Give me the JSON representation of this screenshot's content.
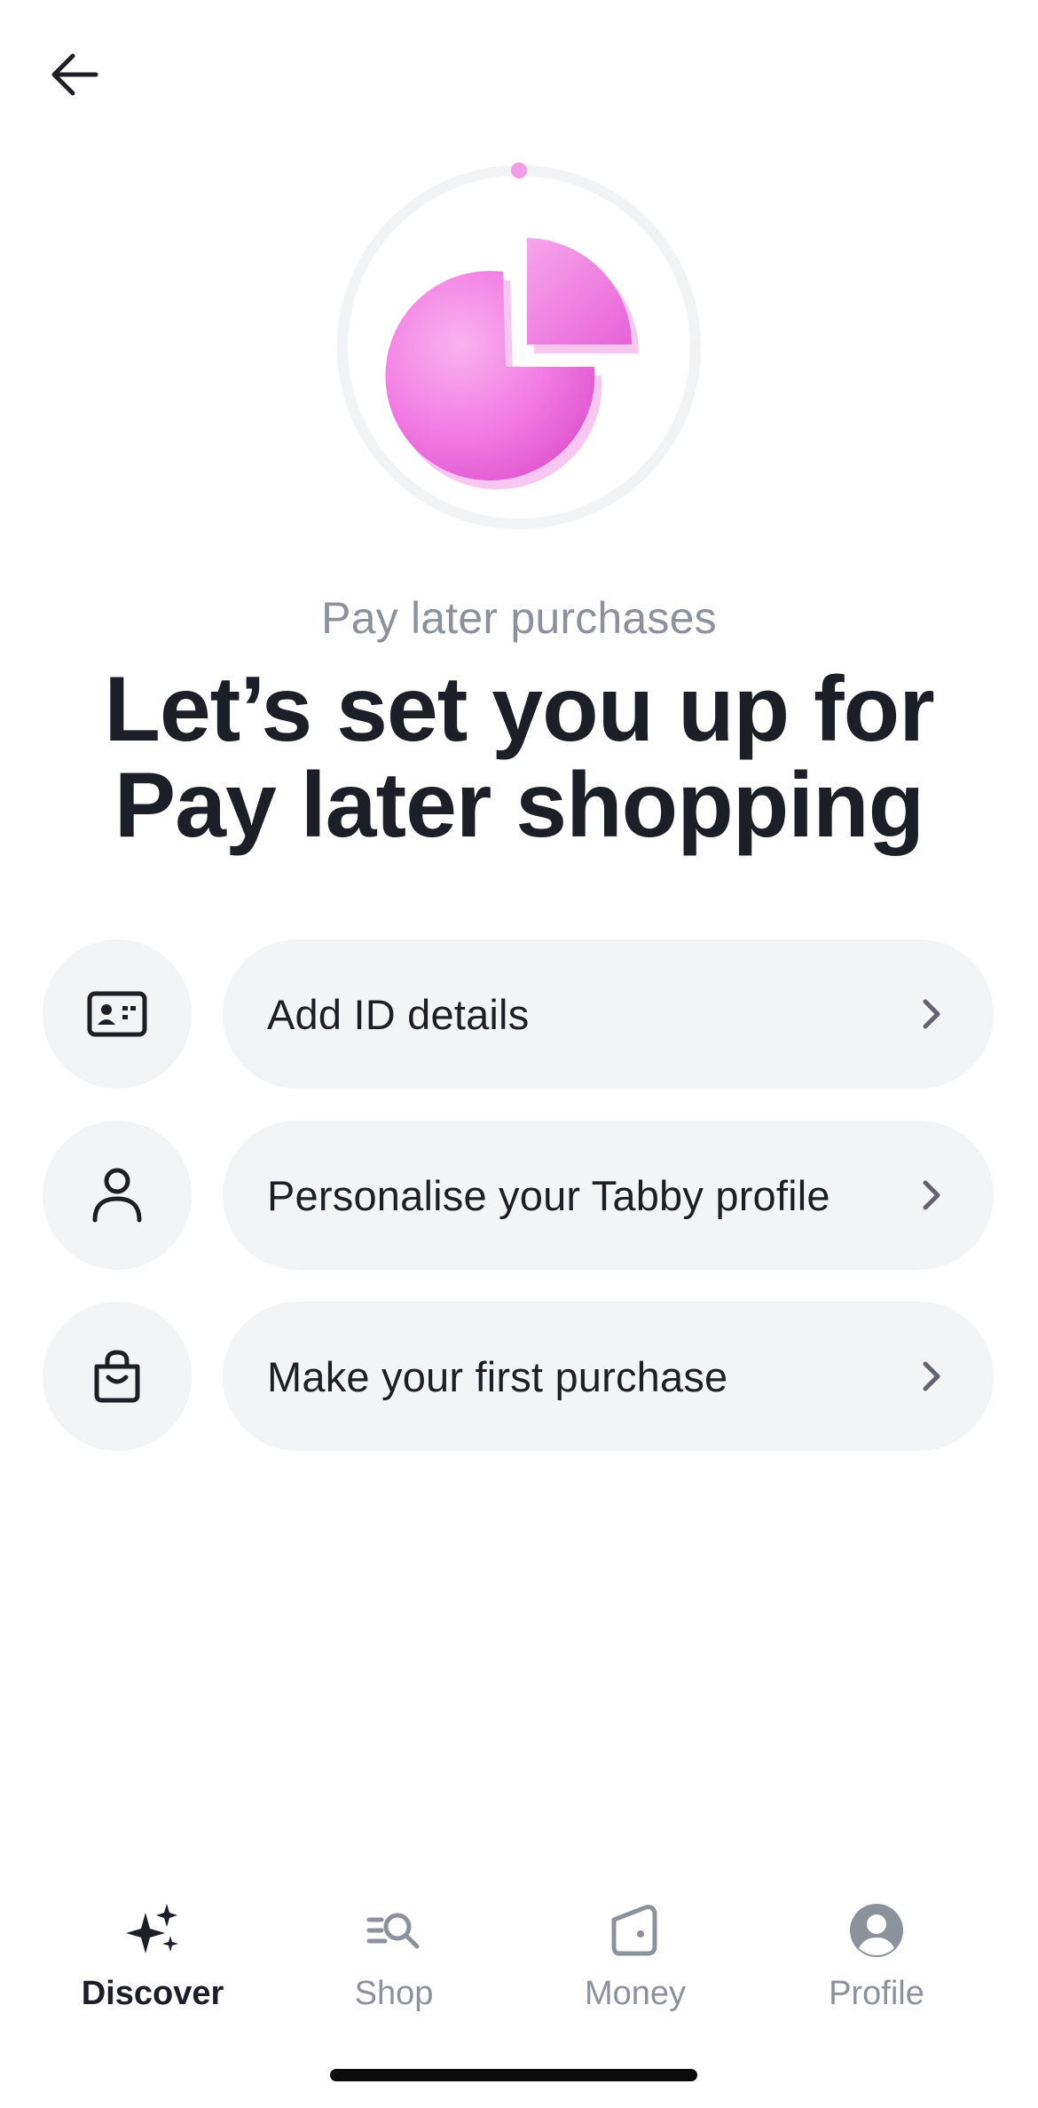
{
  "header": {
    "back_icon": "arrow-left-icon"
  },
  "hero": {
    "icon": "pie-chart-illustration",
    "accent_color": "#f27ee4"
  },
  "intro": {
    "subtitle": "Pay later purchases",
    "title_line1": "Let’s set you up for",
    "title_line2": "Pay later shopping"
  },
  "steps": [
    {
      "icon": "id-card-icon",
      "label": "Add ID details"
    },
    {
      "icon": "person-icon",
      "label": "Personalise your Tabby profile"
    },
    {
      "icon": "shopping-bag-icon",
      "label": "Make your first purchase"
    }
  ],
  "tabbar": {
    "active": "Discover",
    "tabs": [
      {
        "label": "Discover",
        "icon": "sparkles-icon"
      },
      {
        "label": "Shop",
        "icon": "search-list-icon"
      },
      {
        "label": "Money",
        "icon": "wallet-icon"
      },
      {
        "label": "Profile",
        "icon": "profile-icon"
      }
    ]
  },
  "colors": {
    "text_primary": "#1c1f27",
    "text_secondary": "#8c929c",
    "surface": "#f3f4f6"
  }
}
